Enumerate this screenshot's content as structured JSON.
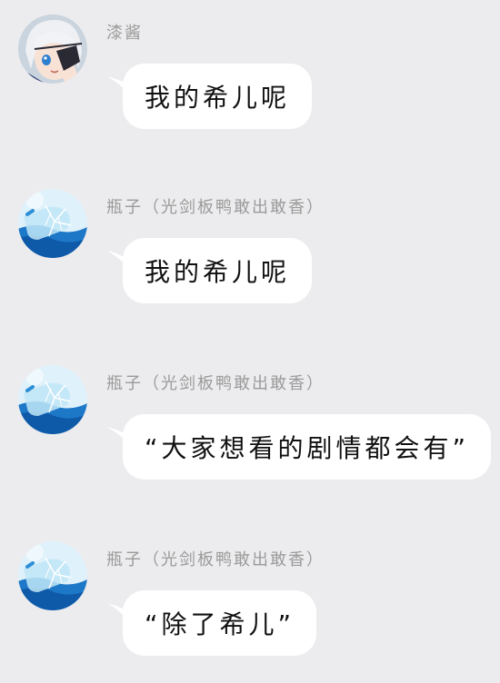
{
  "messages": [
    {
      "sender": "漆酱",
      "text": "我的希儿呢",
      "avatar_icon": "white-haired-anime-girl-avatar-icon"
    },
    {
      "sender": "瓶子（光剑板鸭敢出敢香）",
      "text": "我的希儿呢",
      "avatar_icon": "bottle-in-water-avatar-icon"
    },
    {
      "sender": "瓶子（光剑板鸭敢出敢香）",
      "text": "“大家想看的剧情都会有”",
      "avatar_icon": "bottle-in-water-avatar-icon"
    },
    {
      "sender": "瓶子（光剑板鸭敢出敢香）",
      "text": "“除了希儿”",
      "avatar_icon": "bottle-in-water-avatar-icon"
    }
  ],
  "colors": {
    "background": "#ececee",
    "bubble": "#ffffff",
    "sender_name": "#9a9a9a",
    "message_text": "#111111"
  }
}
